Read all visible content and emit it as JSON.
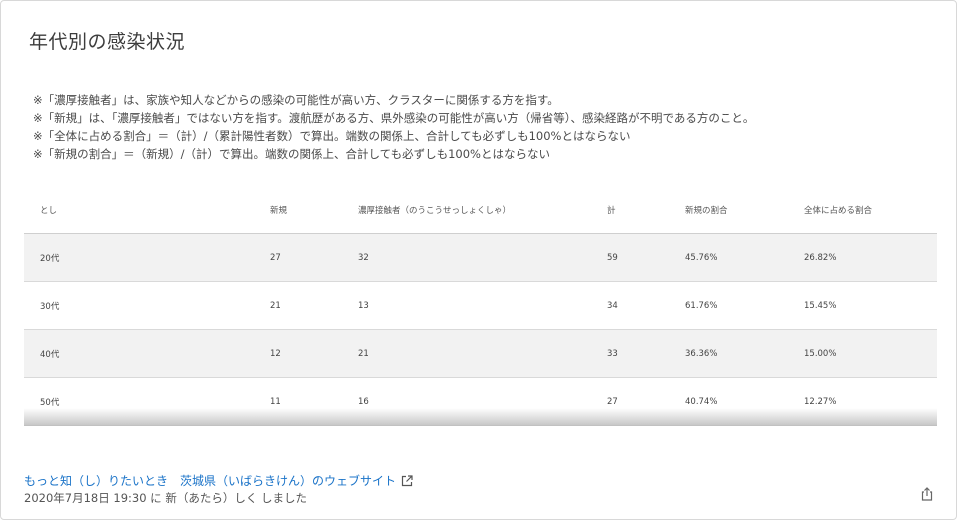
{
  "title": "年代別の感染状況",
  "notes": [
    "※「濃厚接触者」は、家族や知人などからの感染の可能性が高い方、クラスターに関係する方を指す。",
    "※「新規」は、「濃厚接触者」ではない方を指す。渡航歴がある方、県外感染の可能性が高い方（帰省等）、感染経路が不明である方のこと。",
    "※「全体に占める割合」＝（計）/（累計陽性者数）で算出。端数の関係上、合計しても必ずしも100%とはならない",
    "※「新規の割合」＝（新規）/（計）で算出。端数の関係上、合計しても必ずしも100%とはならない"
  ],
  "table": {
    "headers": [
      "とし",
      "新規",
      "濃厚接触者（のうこうせっしょくしゃ）",
      "計",
      "新規の割合",
      "全体に占める割合"
    ],
    "rows": [
      [
        "20代",
        "27",
        "32",
        "59",
        "45.76%",
        "26.82%"
      ],
      [
        "30代",
        "21",
        "13",
        "34",
        "61.76%",
        "15.45%"
      ],
      [
        "40代",
        "12",
        "21",
        "33",
        "36.36%",
        "15.00%"
      ],
      [
        "50代",
        "11",
        "16",
        "27",
        "40.74%",
        "12.27%"
      ]
    ]
  },
  "footer": {
    "link_text": "もっと知（し）りたいとき　茨城県（いばらきけん）のウェブサイト",
    "updated": "2020年7月18日 19:30 に 新（あたら）しく しました"
  },
  "icons": {
    "external_link": "external-link-icon",
    "share": "share-icon"
  },
  "colors": {
    "link": "#1a73c8",
    "row_shade": "#f2f2f2"
  }
}
